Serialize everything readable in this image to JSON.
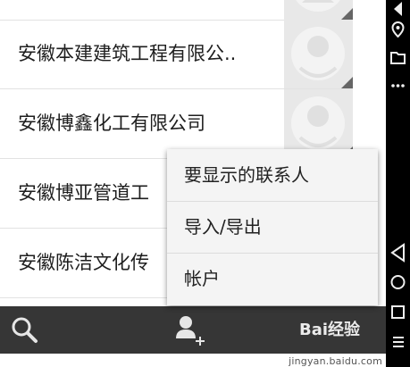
{
  "contacts": [
    {
      "name": ""
    },
    {
      "name": "安徽本建建筑工程有限公.."
    },
    {
      "name": "安徽博鑫化工有限公司"
    },
    {
      "name": "安徽博亚管道工"
    },
    {
      "name": "安徽陈洁文化传"
    }
  ],
  "menu": {
    "items": [
      {
        "label": "要显示的联系人"
      },
      {
        "label": "导入/导出"
      },
      {
        "label": "帐户"
      }
    ]
  },
  "bottom_bar": {
    "search_icon": "search-icon",
    "add_contact_icon": "add-contact-icon"
  },
  "system_bar": {
    "icons": [
      "triangle-top-icon",
      "location-icon",
      "folder-icon",
      "more-icon",
      "back-icon",
      "home-icon",
      "recents-icon",
      "list-icon"
    ]
  },
  "watermark": {
    "logo": "Bai经验",
    "url": "jingyan.baidu.com"
  },
  "colors": {
    "bottom_bar": "#363636",
    "system_bar": "#000000",
    "menu_bg": "#f4f4f4",
    "avatar_bg": "#e8e8e8"
  }
}
